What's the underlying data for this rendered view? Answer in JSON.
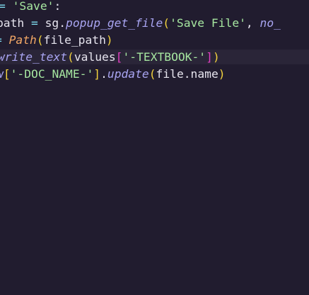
{
  "editor": {
    "lines": [
      {
        "a": "=",
        "b": " ",
        "c": "'Save'",
        "d": ":"
      },
      {
        "a": "path ",
        "b": "=",
        "c": " sg.",
        "d": "popup_get_file",
        "e": "(",
        "f": "'Save File'",
        "g": ", ",
        "h": "no_"
      },
      {
        "a": "=",
        "b": " ",
        "c": "Path",
        "d": "(",
        "e": "file_path",
        "f": ")"
      },
      {
        "a": "write_text",
        "b": "(",
        "c": "values",
        "d": "[",
        "e": "'-TEXTBOOK-'",
        "f": "]",
        "g": ")"
      },
      {
        "a": "w",
        "b": "[",
        "c": "'-DOC_NAME-'",
        "d": "]",
        "e": ".",
        "f": "update",
        "g": "(",
        "h": "file.name",
        "i": ")"
      },
      {
        "a": ")"
      }
    ],
    "colors": {
      "background": "#211c2f",
      "current_line": "#2a2538"
    }
  }
}
